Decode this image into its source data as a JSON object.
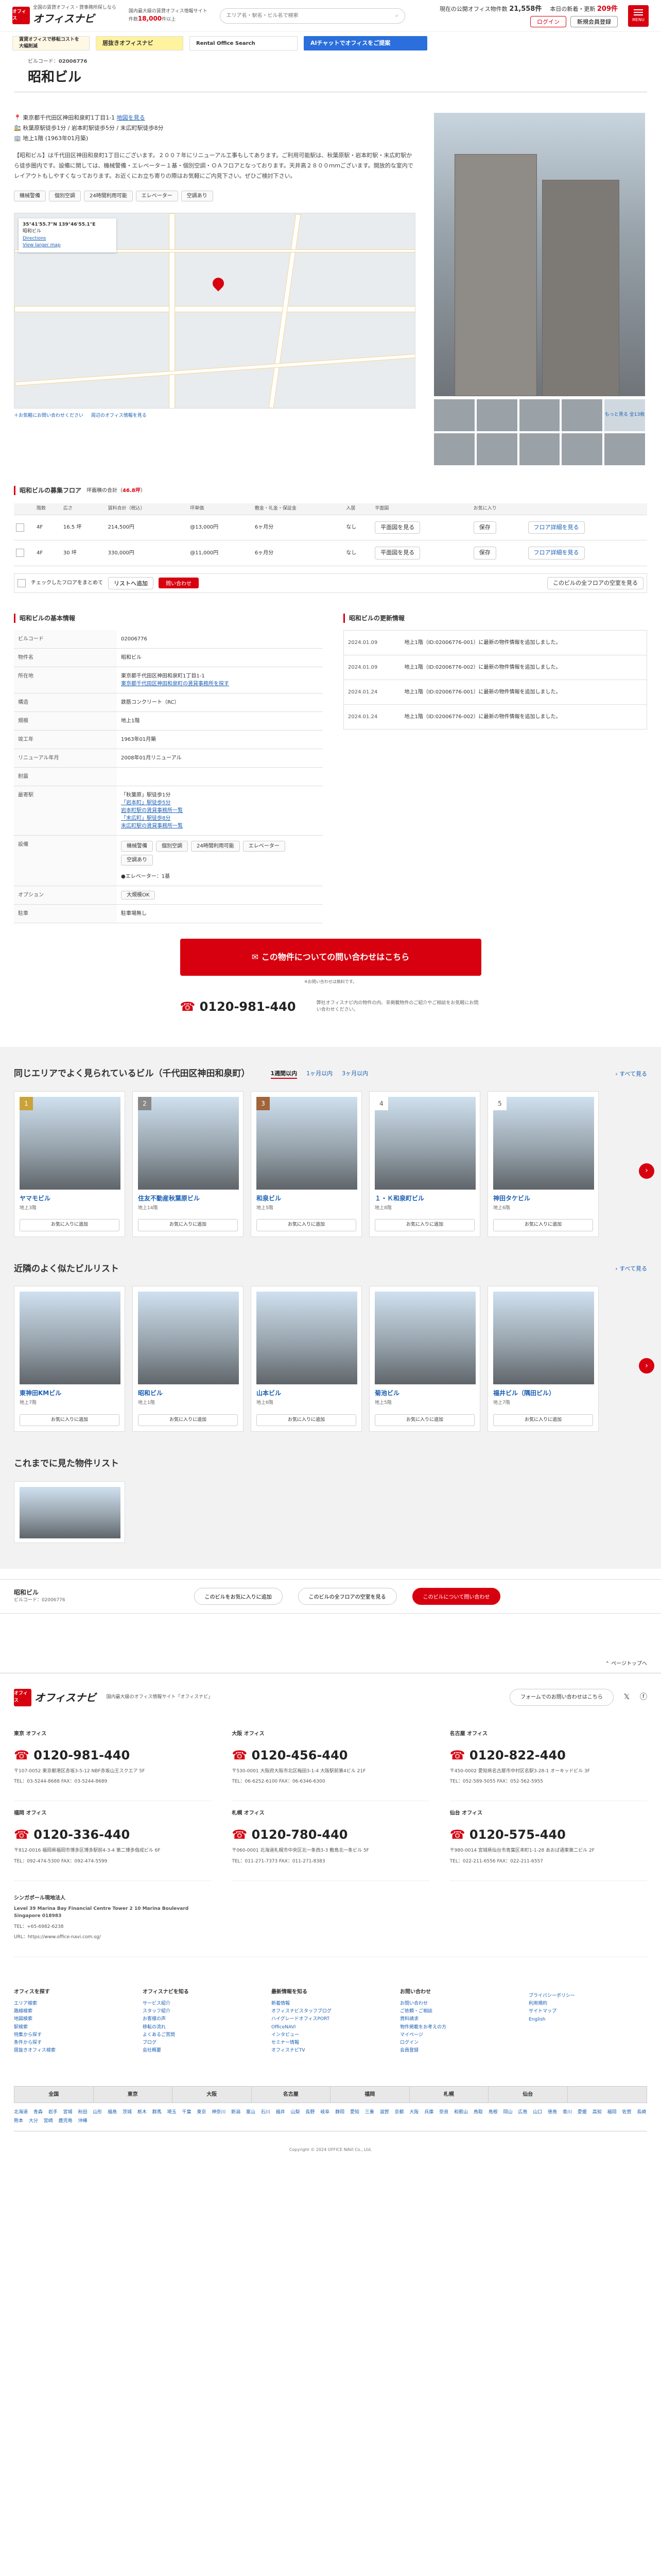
{
  "header": {
    "logo_mark": "オフィス",
    "logo_text": "オフィスナビ",
    "logo_tag": "全国の賃貸オフィス・貸事務所探しなら",
    "sub_line1": "国内最大級の賃貸オフィス情報サイト",
    "sub_line2_prefix": "件数",
    "sub_count": "18,000",
    "sub_suffix": "件以上",
    "search_placeholder": "エリア名・駅名・ビル名で検索",
    "stat1_label": "現在の公開オフィス物件数",
    "stat1_value": "21,558件",
    "stat2_label": "本日の新着・更新",
    "stat2_value": "209件",
    "login": "ログイン",
    "signup": "新規会員登録",
    "menu": "MENU"
  },
  "banners": {
    "b1": "賃貸オフィスで移転コストを大幅削減",
    "b2": "居抜きオフィスナビ",
    "b3": "Rental Office Search",
    "b4": "AIチャットでオフィスをご提案"
  },
  "building": {
    "code_label": "ビルコード：",
    "code": "02006776",
    "name": "昭和ビル",
    "address": "東京都千代田区神田和泉町1丁目1-1",
    "map_link": "地図を見る",
    "station1": "秋葉原駅徒歩1分 / 岩本町駅徒歩5分 / 末広町駅徒歩8分",
    "floors": "地上1階 (1963年01月築)",
    "description": "【昭和ビル】は千代田区神田和泉町1丁目にございます。２００７年にリニューアル工事もしてあります。ご利用可能駅は、秋葉原駅・岩本町駅・末広町駅から徒歩圏内です。設備に関しては、機械警備・エレベーター１基・個別空調・ＯＡフロアとなっております。天井高２８００ｍｍございます。開放的な室内でレイアウトもしやすくなっております。お近くにお立ち寄りの際はお気軽にご内見下さい。ぜひご検討下さい。"
  },
  "tags": [
    "機械警備",
    "個別空調",
    "24時間利用可能",
    "エレベーター",
    "空調あり"
  ],
  "map": {
    "coords": "35°41'55.7\"N 139°46'55.1\"E",
    "place": "昭和ビル",
    "directions": "Directions",
    "larger": "View larger map",
    "foot1": "＋お気軽にお問い合わせください",
    "foot2": "周辺のオフィス情報を見る"
  },
  "photos": {
    "more": "もっと見る 全13枚"
  },
  "vacancy": {
    "title": "昭和ビルの募集フロア",
    "count_label": "坪面積の合計（",
    "count_value": "46.8坪",
    "count_suffix": "）",
    "headers": [
      "階数",
      "広さ",
      "賃料合計（税込）",
      "坪単価",
      "敷金・礼金・保証金",
      "入居",
      "平面図",
      "お気に入り",
      ""
    ],
    "rows": [
      {
        "floor": "4F",
        "area": "16.5 坪",
        "rent": "214,500円",
        "unit": "@13,000円",
        "deposit": "6ヶ月分",
        "move": "なし",
        "plan": "平面図を見る",
        "fav": "保存",
        "link": "フロア詳細を見る"
      },
      {
        "floor": "4F",
        "area": "30 坪",
        "rent": "330,000円",
        "unit": "@11,000円",
        "deposit": "6ヶ月分",
        "move": "なし",
        "plan": "平面図を見る",
        "fav": "保存",
        "link": "フロア詳細を見る"
      }
    ],
    "bulk_label": "チェックしたフロアをまとめて",
    "bulk_list": "リストへ追加",
    "bulk_inquiry": "問い合わせ",
    "all_link": "このビルの全フロアの空室を見る"
  },
  "info": {
    "title": "昭和ビルの基本情報",
    "rows": [
      {
        "k": "ビルコード",
        "v": "02006776"
      },
      {
        "k": "物件名",
        "v": "昭和ビル"
      },
      {
        "k": "所在地",
        "v": "東京都千代田区神田和泉町1丁目1-1"
      },
      {
        "k": "構造",
        "v": "鉄筋コンクリート（RC）"
      },
      {
        "k": "規模",
        "v": "地上1階"
      },
      {
        "k": "竣工年",
        "v": "1963年01月築"
      },
      {
        "k": "リニューアル年月",
        "v": "2008年01月リニューアル"
      },
      {
        "k": "耐震",
        "v": ""
      },
      {
        "k": "最寄駅",
        "v": "「秋葉原」駅徒歩1分"
      },
      {
        "k": "設備",
        "v": "機械警備"
      },
      {
        "k": "オプション",
        "v": "大規模OK"
      },
      {
        "k": "駐車",
        "v": "駐車場無し"
      }
    ],
    "address_link": "東京都千代田区神田和泉町の賃貸事務所を探す",
    "station_lines": [
      "「岩本町」駅徒歩5分",
      "岩本町駅の賃貸事務所一覧",
      "「末広町」駅徒歩8分",
      "末広町駅の賃貸事務所一覧"
    ],
    "elevator": "●エレベーター：1基"
  },
  "history": {
    "title": "昭和ビルの更新情報",
    "rows": [
      {
        "d": "2024.01.09",
        "t": "地上1階（ID:02006776-001）に最新の物件情報を追加しました。"
      },
      {
        "d": "2024.01.09",
        "t": "地上1階（ID:02006776-002）に最新の物件情報を追加しました。"
      },
      {
        "d": "2024.01.24",
        "t": "地上1階（ID:02006776-001）に最新の物件情報を追加しました。"
      },
      {
        "d": "2024.01.24",
        "t": "地上1階（ID:02006776-002）に最新の物件情報を追加しました。"
      }
    ]
  },
  "cta": {
    "label": "この物件についての問い合わせはこちら",
    "note": "※お問い合わせは無料です。",
    "tel": "0120-981-440",
    "tel_note": "弊社オフィスナビ内の物件の内、非掲載物件のご紹介やご相談をお気軽にお問い合わせください。"
  },
  "carousel1": {
    "title": "同じエリアでよく見られているビル（千代田区神田和泉町）",
    "tabs": [
      "1週間以内",
      "1ヶ月以内",
      "3ヶ月以内"
    ],
    "more": "すべて見る",
    "cards": [
      {
        "rank": "1",
        "name": "ヤマモビル",
        "meta": "地上3階",
        "fav": "お気に入りに追加"
      },
      {
        "rank": "2",
        "name": "住友不動産秋葉原ビル",
        "meta": "地上14階",
        "fav": "お気に入りに追加"
      },
      {
        "rank": "3",
        "name": "和泉ビル",
        "meta": "地上5階",
        "fav": "お気に入りに追加"
      },
      {
        "rank": "4",
        "name": "１・Ｋ和泉町ビル",
        "meta": "地上8階",
        "fav": "お気に入りに追加"
      },
      {
        "rank": "5",
        "name": "神田タケビル",
        "meta": "地上6階",
        "fav": "お気に入りに追加"
      }
    ]
  },
  "carousel2": {
    "title": "近隣のよく似たビルリスト",
    "more": "すべて見る",
    "cards": [
      {
        "name": "東神田KMビル",
        "meta": "地上7階",
        "fav": "お気に入りに追加"
      },
      {
        "name": "昭和ビル",
        "meta": "地上1階",
        "fav": "お気に入りに追加"
      },
      {
        "name": "山本ビル",
        "meta": "地上6階",
        "fav": "お気に入りに追加"
      },
      {
        "name": "菊池ビル",
        "meta": "地上5階",
        "fav": "お気に入りに追加"
      },
      {
        "name": "福井ビル（隅田ビル）",
        "meta": "地上7階",
        "fav": "お気に入りに追加"
      }
    ]
  },
  "recent": {
    "title": "これまでに見た物件リスト",
    "name": "昭和ビル",
    "code": "ビルコード：02006776",
    "b1": "このビルをお気に入りに追加",
    "b2": "このビルの全フロアの空室を見る",
    "b3": "このビルについて問い合わせ"
  },
  "footer": {
    "pagetop": "ページトップへ",
    "company_line": "国内最大級のオフィス情報サイト「オフィスナビ」",
    "contact": "フォームでのお問い合わせはこちら",
    "offices": [
      {
        "name": "東京 オフィス",
        "tel": "0120-981-440",
        "addr": "〒107-0052 東京都港区赤坂3-5-12 NBF赤坂山王スクエア 5F",
        "fax": "TEL：03-5244-8688 FAX：03-5244-8689"
      },
      {
        "name": "大阪 オフィス",
        "tel": "0120-456-440",
        "addr": "〒530-0001 大阪府大阪市北区梅田3-1-4 大阪駅前第4ビル 21F",
        "fax": "TEL：06-6252-6100 FAX：06-6346-6300"
      },
      {
        "name": "名古屋 オフィス",
        "tel": "0120-822-440",
        "addr": "〒450-0002 愛知県名古屋市中村区名駅3-28-1 オーキッドビル 3F",
        "fax": "TEL：052-589-5055 FAX：052-562-5955"
      },
      {
        "name": "福岡 オフィス",
        "tel": "0120-336-440",
        "addr": "〒812-0016 福岡県福岡市博多区博多駅前4-3-4 第二博多偕成ビル 6F",
        "fax": "TEL：092-474-5300 FAX：092-474-5599"
      },
      {
        "name": "札幌 オフィス",
        "tel": "0120-780-440",
        "addr": "〒060-0001 北海道札幌市中央区北一条西3-3 敷島北一条ビル 5F",
        "fax": "TEL：011-271-7373 FAX：011-271-8383"
      },
      {
        "name": "仙台 オフィス",
        "tel": "0120-575-440",
        "addr": "〒980-0014 宮城県仙台市青葉区本町1-1-28 あおば通東第二ビル 2F",
        "fax": "TEL：022-211-6556 FAX：022-211-6557"
      }
    ],
    "sg_title": "シンガポール現地法人",
    "sg_addr": "Level 39 Marina Bay Financial Centre Tower 2 10 Marina Boulevard Singapore 018983",
    "sg_tel": "TEL：+65-6982-6238",
    "sg_url": "URL：https://www.office-navi.com.sg/",
    "cols": [
      {
        "h": "オフィスを探す",
        "items": [
          "エリア検索",
          "路線検索",
          "地図検索",
          "駅検索",
          "特集から探す",
          "条件から探す",
          "居抜きオフィス検索"
        ]
      },
      {
        "h": "オフィスナビを知る",
        "items": [
          "サービス紹介",
          "スタッフ紹介",
          "お客様の声",
          "移転の流れ",
          "よくあるご質問",
          "ブログ",
          "会社概要"
        ]
      },
      {
        "h": "最新情報を知る",
        "items": [
          "新着情報",
          "オフィスナビスタッフブログ",
          "ハイグレードオフィスPORT",
          "OfficeNAVI",
          "インタビュー",
          "セミナー情報",
          "オフィスナビTV"
        ]
      },
      {
        "h": "お問い合わせ",
        "items": [
          "お問い合わせ",
          "ご依頼・ご相談",
          "資料請求",
          "物件掲載をお考えの方",
          "マイページ",
          "ログイン",
          "会員登録"
        ]
      },
      {
        "h": "",
        "items": [
          "プライバシーポリシー",
          "利用規約",
          "サイトマップ",
          "English"
        ]
      }
    ],
    "areas": [
      "全国",
      "東京",
      "大阪",
      "名古屋",
      "福岡",
      "札幌",
      "仙台",
      ""
    ],
    "prefs": "北海道 青森 岩手 宮城 秋田 山形 福島 茨城 栃木 群馬 埼玉 千葉 東京 神奈川 新潟 富山 石川 福井 山梨 長野 岐阜 静岡 愛知 三重 滋賀 京都 大阪 兵庫 奈良 和歌山 鳥取 島根 岡山 広島 山口 徳島 香川 愛媛 高知 福岡 佐賀 長崎 熊本 大分 宮崎 鹿児島 沖縄",
    "copyright": "Copyright © 2024 OFFICE NAVI Co., Ltd."
  }
}
